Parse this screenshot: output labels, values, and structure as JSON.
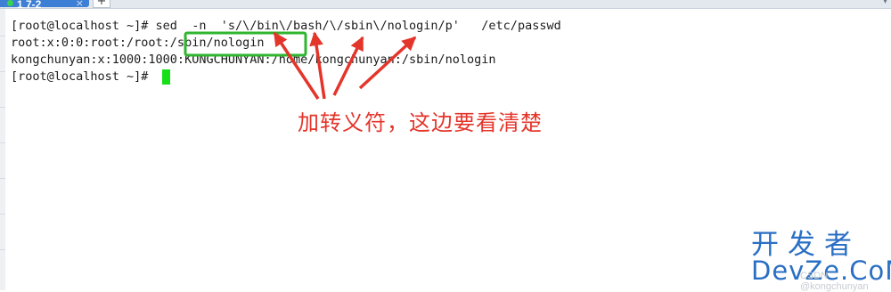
{
  "tab": {
    "label": "1 7-2",
    "close": "×",
    "new_tab": "+",
    "right_icon": "▾"
  },
  "terminal": {
    "lines": [
      "[root@localhost ~]# sed  -n  's/\\/bin\\/bash/\\/sbin\\/nologin/p'   /etc/passwd",
      "root:x:0:0:root:/root:/sbin/nologin",
      "kongchunyan:x:1000:1000:KONGCHUNYAN:/home/kongchunyan:/sbin/nologin",
      "[root@localhost ~]# "
    ]
  },
  "annotation": {
    "note": "加转义符，这边要看清楚",
    "color": "#e4352b",
    "highlight_color": "#2fb52f"
  },
  "watermark": {
    "cn": "开发者",
    "en": "DevZe.CoM",
    "sub": "CSDN @kongchunyan"
  },
  "colors": {
    "tab_bg": "#3c7fd4",
    "cursor": "#18e018",
    "text": "#1c1c1c",
    "watermark": "#2a6fc4"
  }
}
